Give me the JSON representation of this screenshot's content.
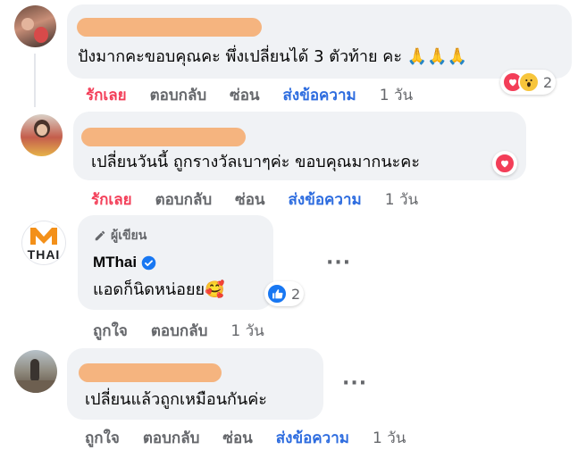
{
  "comments": [
    {
      "text": "ปังมากคะขอบคุณคะ พึ่งเปลี่ยนได้ 3 ตัวท้าย คะ",
      "emoji": "🙏🙏🙏",
      "actions": {
        "like": "รักเลย",
        "reply": "ตอบกลับ",
        "hide": "ซ่อน",
        "message": "ส่งข้อความ",
        "time": "1 วัน"
      },
      "reaction_count": "2",
      "reaction_icons": [
        "heart-icon",
        "wow-icon"
      ]
    },
    {
      "text": "เปลี่ยนวันนี้ ถูกรางวัลเบาๆค่ะ ขอบคุณมากนะคะ",
      "actions": {
        "like": "รักเลย",
        "reply": "ตอบกลับ",
        "hide": "ซ่อน",
        "message": "ส่งข้อความ",
        "time": "1 วัน"
      },
      "reaction_icons": [
        "heart-icon"
      ]
    },
    {
      "author_badge": "ผู้เขียน",
      "author_name": "MThai",
      "avatar_text": "THAI",
      "avatar_letter": "M",
      "text": "แอดก็นิดหน่อยย",
      "emoji": "🥰",
      "actions": {
        "like": "ถูกใจ",
        "reply": "ตอบกลับ",
        "time": "1 วัน"
      },
      "reaction_count": "2",
      "reaction_icons": [
        "like-icon"
      ]
    },
    {
      "text": "เปลี่ยนแล้วถูกเหมือนกันค่ะ",
      "actions": {
        "like": "ถูกใจ",
        "reply": "ตอบกลับ",
        "hide": "ซ่อน",
        "message": "ส่งข้อความ",
        "time": "1 วัน"
      }
    }
  ],
  "colors": {
    "bubble": "#f0f2f5",
    "redaction": "#f5b47f",
    "love_red": "#f33e58",
    "message_blue": "#2d6cdf",
    "mthai_orange": "#f39019"
  }
}
